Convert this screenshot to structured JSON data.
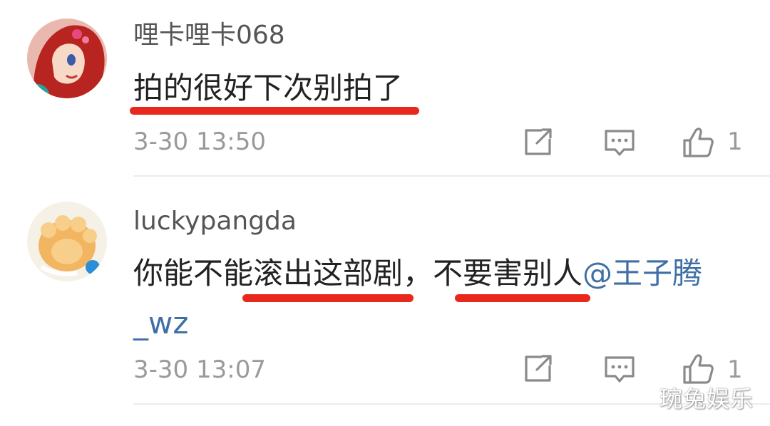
{
  "comments": [
    {
      "username": "哩卡哩卡068",
      "text": "拍的很好下次别拍了",
      "time": "3-30 13:50",
      "like_count": "1"
    },
    {
      "username": "luckypangda",
      "text_part1": "你能不能滚出这部剧，不要害别人",
      "mention_part1": "@王子腾",
      "mention_part2": "_wz",
      "time": "3-30 13:07",
      "like_count": "1"
    }
  ],
  "icons": {
    "share": "share-icon",
    "comment": "comment-icon",
    "like": "thumbs-up-icon"
  },
  "colors": {
    "mention": "#3F6FA6",
    "underline": "#E8281C"
  },
  "watermark": "琬兔娱乐"
}
